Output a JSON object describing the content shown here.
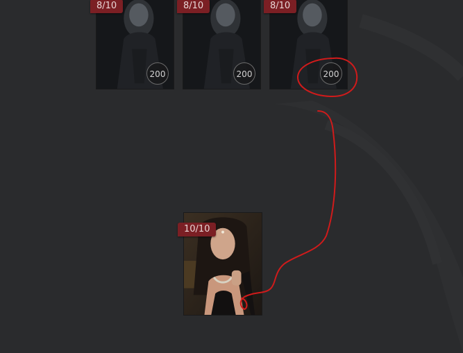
{
  "deck": {
    "cards": [
      {
        "rank": "8/10",
        "cost": "200"
      },
      {
        "rank": "8/10",
        "cost": "200"
      },
      {
        "rank": "8/10",
        "cost": "200"
      }
    ]
  },
  "featured_card": {
    "rank": "10/10"
  },
  "colors": {
    "background": "#2a2b2d",
    "badge": "#7b1f24",
    "annotation": "#d11b1b"
  }
}
